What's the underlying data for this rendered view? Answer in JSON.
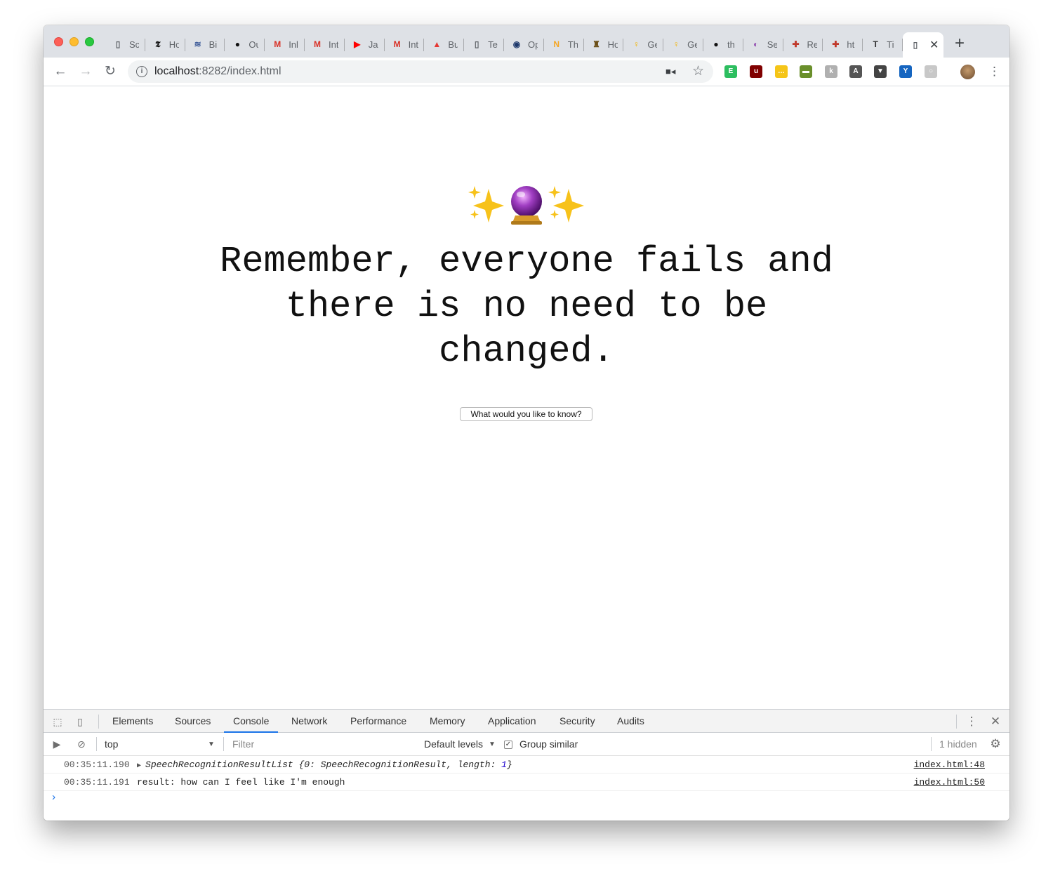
{
  "browser": {
    "tabs": [
      {
        "title": "Sc",
        "icon": "document-icon",
        "color": "#5f6368",
        "glyph": "▯"
      },
      {
        "title": "Ho",
        "icon": "nytimes-icon",
        "color": "#111111",
        "glyph": "𝕿"
      },
      {
        "title": "Bi",
        "icon": "stack-icon",
        "color": "#3b5998",
        "glyph": "≋"
      },
      {
        "title": "Oʋ",
        "icon": "github-icon",
        "color": "#111111",
        "glyph": "●"
      },
      {
        "title": "Inl",
        "icon": "gmail-icon",
        "color": "#d93025",
        "glyph": "M"
      },
      {
        "title": "Int",
        "icon": "gmail-icon",
        "color": "#d93025",
        "glyph": "M"
      },
      {
        "title": "Ja",
        "icon": "youtube-icon",
        "color": "#ff0000",
        "glyph": "▶"
      },
      {
        "title": "Int",
        "icon": "gmail-icon",
        "color": "#d93025",
        "glyph": "M"
      },
      {
        "title": "Bu",
        "icon": "drop-icon",
        "color": "#e53935",
        "glyph": "▲"
      },
      {
        "title": "Te",
        "icon": "document-icon",
        "color": "#5f6368",
        "glyph": "▯"
      },
      {
        "title": "Op",
        "icon": "circle-icon",
        "color": "#1f3a6d",
        "glyph": "◉"
      },
      {
        "title": "Th",
        "icon": "n-icon",
        "color": "#f5a623",
        "glyph": "N"
      },
      {
        "title": "Ho",
        "icon": "crest-icon",
        "color": "#6b4e16",
        "glyph": "♜"
      },
      {
        "title": "Ge",
        "icon": "bulb-icon",
        "color": "#f4b400",
        "glyph": "♀"
      },
      {
        "title": "Ge",
        "icon": "bulb-icon",
        "color": "#f4b400",
        "glyph": "♀"
      },
      {
        "title": "th",
        "icon": "github-icon",
        "color": "#111111",
        "glyph": "●"
      },
      {
        "title": "Se",
        "icon": "purple-icon",
        "color": "#8e44ad",
        "glyph": "◐"
      },
      {
        "title": "Re",
        "icon": "cross-icon",
        "color": "#c0392b",
        "glyph": "✚"
      },
      {
        "title": "ht",
        "icon": "cross-icon",
        "color": "#c0392b",
        "glyph": "✚"
      },
      {
        "title": "Ti",
        "icon": "tt-icon",
        "color": "#333333",
        "glyph": "T"
      }
    ],
    "active_tab_icon": "document-icon",
    "url_host": "localhost",
    "url_rest": ":8282/index.html",
    "extensions": [
      {
        "name": "evernote-icon",
        "color": "#2dbe60",
        "glyph": "E"
      },
      {
        "name": "ublock-icon",
        "color": "#800000",
        "glyph": "u"
      },
      {
        "name": "dots-extension-icon",
        "color": "#f5c518",
        "glyph": "…"
      },
      {
        "name": "grass-extension-icon",
        "color": "#6a8f2b",
        "glyph": "▬"
      },
      {
        "name": "kanji-extension-icon",
        "color": "#b0b0b0",
        "glyph": "k"
      },
      {
        "name": "a-extension-icon",
        "color": "#555555",
        "glyph": "A"
      },
      {
        "name": "bookmark-extension-icon",
        "color": "#444444",
        "glyph": "▼"
      },
      {
        "name": "y-extension-icon",
        "color": "#1565c0",
        "glyph": "Y"
      },
      {
        "name": "circle-extension-icon",
        "color": "#c8c8c8",
        "glyph": "○"
      }
    ]
  },
  "page": {
    "emoji": "✨🔮✨",
    "quote": "Remember, everyone fails and there is no need to be changed.",
    "ask_button": "What would you like to know?"
  },
  "devtools": {
    "tabs": [
      "Elements",
      "Sources",
      "Console",
      "Network",
      "Performance",
      "Memory",
      "Application",
      "Security",
      "Audits"
    ],
    "active_tab": "Console",
    "context": "top",
    "filter_placeholder": "Filter",
    "levels": "Default levels",
    "group_similar": "Group similar",
    "hidden": "1 hidden",
    "logs": [
      {
        "time": "00:35:11.190",
        "message_prefix": "SpeechRecognitionResultList {0: SpeechRecognitionResult, length: ",
        "message_num": "1",
        "message_suffix": "}",
        "source": "index.html:48"
      },
      {
        "time": "00:35:11.191",
        "message": "result: how can I feel like I'm enough",
        "source": "index.html:50"
      }
    ]
  }
}
